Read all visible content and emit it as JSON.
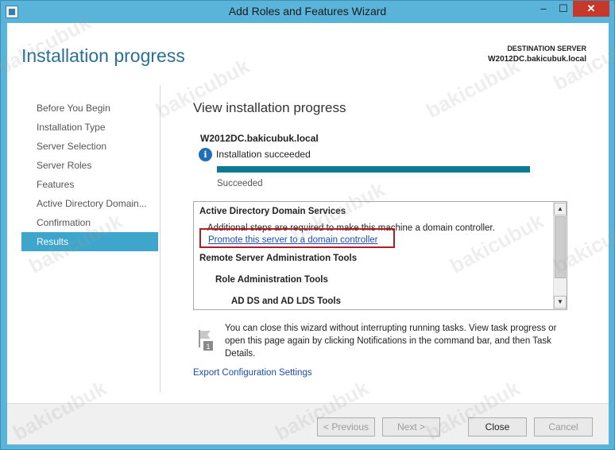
{
  "window": {
    "title": "Add Roles and Features Wizard"
  },
  "window_controls": {
    "minimize": "–",
    "maximize": "☐",
    "close": "✕"
  },
  "header": {
    "page_title": "Installation progress",
    "destination_label": "DESTINATION SERVER",
    "destination_server": "W2012DC.bakicubuk.local"
  },
  "nav": {
    "items": [
      {
        "label": "Before You Begin"
      },
      {
        "label": "Installation Type"
      },
      {
        "label": "Server Selection"
      },
      {
        "label": "Server Roles"
      },
      {
        "label": "Features"
      },
      {
        "label": "Active Directory Domain..."
      },
      {
        "label": "Confirmation"
      },
      {
        "label": "Results"
      }
    ],
    "active_index": 7
  },
  "content": {
    "title": "View installation progress",
    "server_name": "W2012DC.bakicubuk.local",
    "status_text": "Installation succeeded",
    "progress_fraction": 1.0,
    "progress_label": "Succeeded",
    "results": {
      "section1": "Active Directory Domain Services",
      "note": "Additional steps are required to make this machine a domain controller.",
      "link": "Promote this server to a domain controller",
      "section2": "Remote Server Administration Tools",
      "section3": "Role Administration Tools",
      "section4": "AD DS and AD LDS Tools"
    },
    "info_note": "You can close this wizard without interrupting running tasks. View task progress or open this page again by clicking Notifications in the command bar, and then Task Details.",
    "export_link": "Export Configuration Settings"
  },
  "footer": {
    "previous": "< Previous",
    "next": "Next >",
    "close": "Close",
    "cancel": "Cancel"
  },
  "watermark": {
    "text": "bakicubuk"
  },
  "colors": {
    "accent": "#3ea6cc",
    "title_blue": "#2b6f96",
    "progress": "#0c7a91",
    "highlight_border": "#b01d24",
    "link": "#1d4bb0"
  }
}
